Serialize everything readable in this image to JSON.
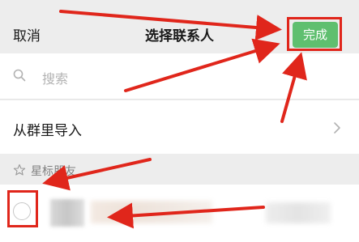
{
  "navbar": {
    "cancel_label": "取消",
    "title": "选择联系人",
    "done_label": "完成"
  },
  "search": {
    "placeholder": "搜索"
  },
  "import_row": {
    "label": "从群里导入"
  },
  "section": {
    "label": "星标朋友"
  },
  "colors": {
    "background": "#ededed",
    "done_button": "#5fbf6f",
    "annotation_red": "#e0261b"
  },
  "icons": {
    "search": "search-icon",
    "chevron": "chevron-right-icon",
    "star": "star-icon"
  }
}
